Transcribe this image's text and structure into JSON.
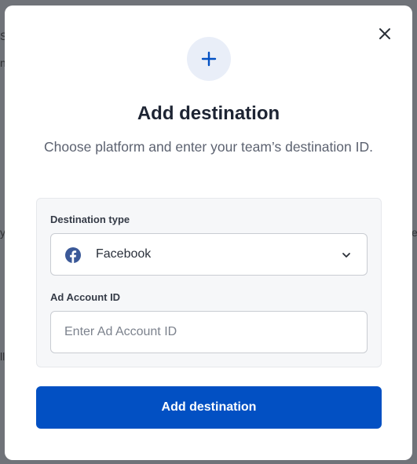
{
  "colors": {
    "accent": "#0250c3",
    "facebook": "#3b5998",
    "badge_bg": "#e9eef8"
  },
  "modal": {
    "close_icon": "close-icon",
    "badge_icon": "plus-icon",
    "title": "Add destination",
    "subtitle": "Choose platform and enter your team’s destination ID.",
    "form": {
      "destination_type": {
        "label": "Destination type",
        "icon": "facebook-icon",
        "selected": "Facebook"
      },
      "ad_account": {
        "label": "Ad Account ID",
        "value": "",
        "placeholder": "Enter Ad Account ID"
      }
    },
    "submit_label": "Add destination"
  }
}
